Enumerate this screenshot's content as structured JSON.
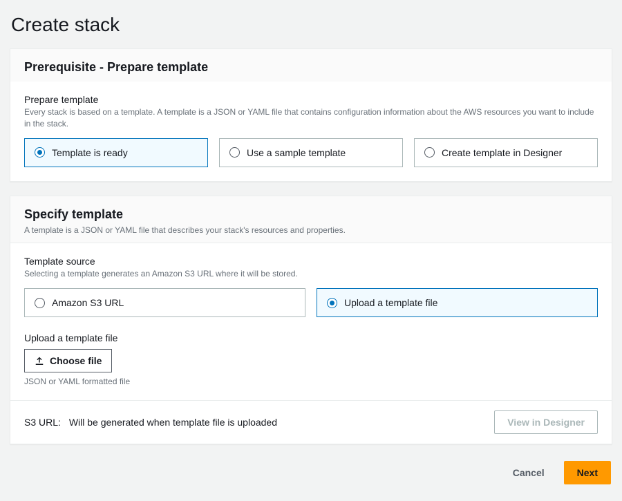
{
  "page": {
    "title": "Create stack"
  },
  "prereq": {
    "panel_title": "Prerequisite - Prepare template",
    "field_label": "Prepare template",
    "field_help": "Every stack is based on a template. A template is a JSON or YAML file that contains configuration information about the AWS resources you want to include in the stack.",
    "options": [
      "Template is ready",
      "Use a sample template",
      "Create template in Designer"
    ],
    "selected_index": 0
  },
  "specify": {
    "panel_title": "Specify template",
    "panel_sub": "A template is a JSON or YAML file that describes your stack's resources and properties.",
    "source_label": "Template source",
    "source_help": "Selecting a template generates an Amazon S3 URL where it will be stored.",
    "source_options": [
      "Amazon S3 URL",
      "Upload a template file"
    ],
    "source_selected_index": 1,
    "upload_label": "Upload a template file",
    "choose_file_label": "Choose file",
    "choose_file_help": "JSON or YAML formatted file",
    "s3_label": "S3 URL:",
    "s3_value": "Will be generated when template file is uploaded",
    "view_designer_label": "View in Designer"
  },
  "nav": {
    "cancel": "Cancel",
    "next": "Next"
  }
}
